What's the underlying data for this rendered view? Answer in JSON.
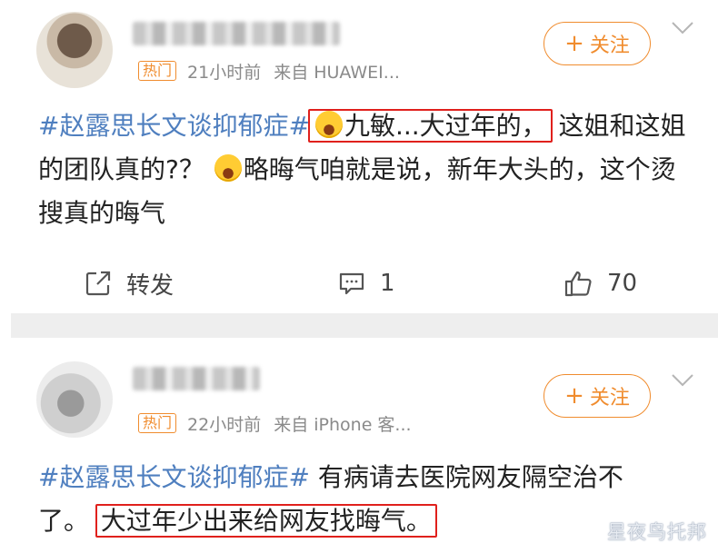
{
  "posts": [
    {
      "badge": "热门",
      "time": "21小时前",
      "source": "来自 HUAWEI...",
      "follow_label": "关注",
      "content": {
        "topic": "#赵露思长文谈抑郁症#",
        "emoji_name": "laugh-cry-emoji",
        "highlight": "九敏...大过年的，",
        "rest": "这姐和这姐的团队真的?？",
        "emoji2_name": "laugh-cry-emoji",
        "tail": "略晦气咱就是说，新年大头的，这个烫搜真的晦气"
      },
      "actions": {
        "repost_label": "转发",
        "comment_count": "1",
        "like_count": "70"
      }
    },
    {
      "badge": "热门",
      "time": "22小时前",
      "source": "来自 iPhone 客...",
      "follow_label": "关注",
      "content": {
        "topic": "#赵露思长文谈抑郁症#",
        "text": " 有病请去医院网友隔空治不了。",
        "highlight": "大过年少出来给网友找晦气。"
      }
    }
  ],
  "watermark": "星夜鸟托邦",
  "colors": {
    "accent": "#f08c2e",
    "topic": "#4f7fbf",
    "highlight_box": "#e0201c"
  }
}
